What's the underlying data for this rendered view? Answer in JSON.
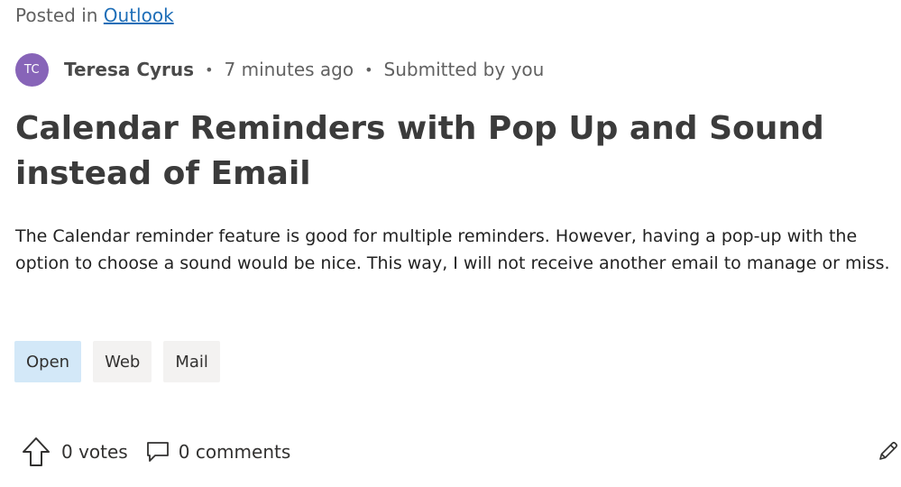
{
  "post": {
    "posted_in_prefix": "Posted in",
    "category_link": "Outlook",
    "author_initials": "TC",
    "author_name": "Teresa Cyrus",
    "time_ago": "7 minutes ago",
    "submitted_by": "Submitted by you",
    "title": "Calendar Reminders with Pop Up and Sound instead of Email",
    "description": "The Calendar reminder feature is good for multiple reminders. However, having a pop-up with the option to choose a sound would be nice. This way, I will not receive another email to manage or miss."
  },
  "tags": {
    "status": "Open",
    "items": [
      "Web",
      "Mail"
    ]
  },
  "footer": {
    "votes_label": "0 votes",
    "comments_label": "0 comments"
  },
  "icons": {
    "upvote": "upvote-arrow-icon",
    "comment": "comment-icon",
    "edit": "pencil-icon"
  },
  "colors": {
    "avatar_bg": "#8764b8",
    "link": "#1f6fb8",
    "status_tag_bg": "#d3e8f8",
    "tag_bg": "#f3f2f1"
  }
}
